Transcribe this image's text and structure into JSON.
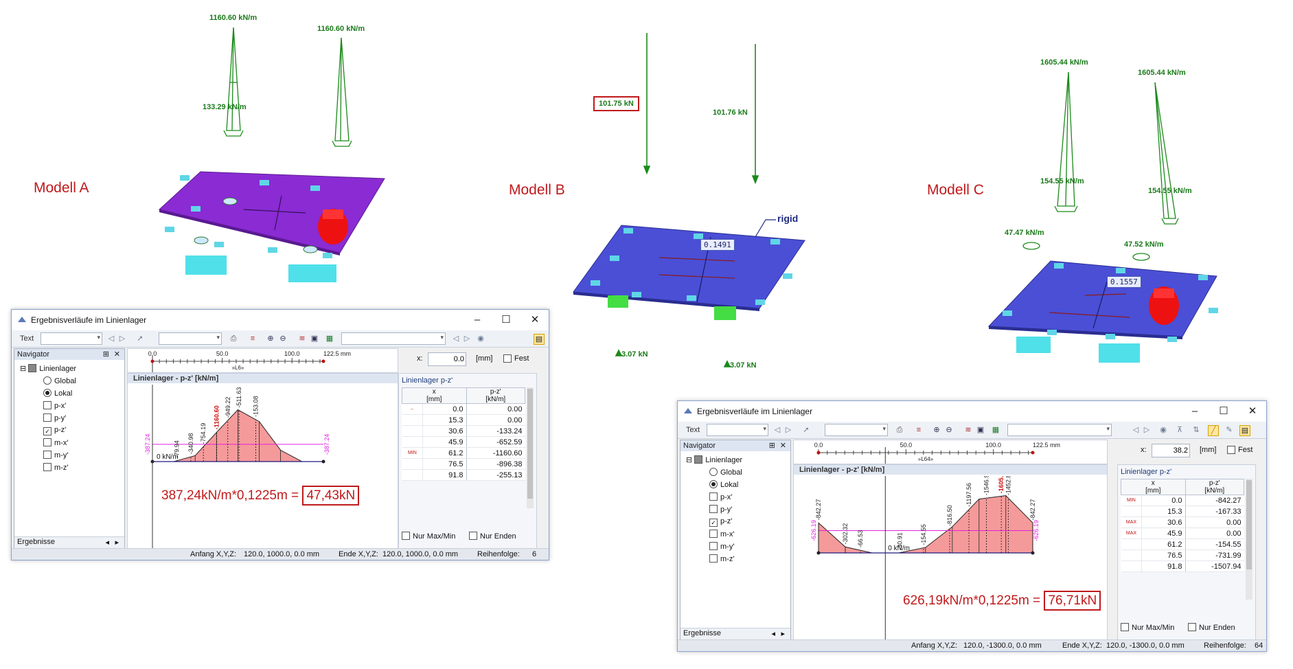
{
  "models": [
    {
      "label": "Modell A"
    },
    {
      "label": "Modell B"
    },
    {
      "label": "Modell C"
    }
  ],
  "model_a": {
    "load_left_top": "1160.60 kN/m",
    "load_right_top": "1160.60 kN/m",
    "load_mid": "133.29 kN/m"
  },
  "model_b": {
    "force_left": "101.75 kN",
    "force_right": "101.76 kN",
    "rigid_label": "rigid",
    "tag_value": "0.1491",
    "support_left": "3.07 kN",
    "support_right": "3.07 kN"
  },
  "model_c": {
    "load_left_top": "1605.44 kN/m",
    "load_right_top": "1605.44 kN/m",
    "load_left_mid": "154.55 kN/m",
    "load_right_mid": "154.55 kN/m",
    "load_left_low": "47.47 kN/m",
    "load_right_low": "47.52 kN/m",
    "tag_value": "0.1557"
  },
  "dialog_a": {
    "title": "Ergebnisverläufe im Linienlager",
    "toolbar_text_label": "Text",
    "navigator_label": "Navigator",
    "tree_root": "Linienlager",
    "tree_items": [
      "Global",
      "Lokal",
      "p-x'",
      "p-y'",
      "p-z'",
      "m-x'",
      "m-y'",
      "m-z'"
    ],
    "nav_footer": "Ergebnisse",
    "ruler_ticks": [
      "0.0",
      "50.0",
      "100.0",
      "122.5 mm"
    ],
    "ruler_member": "»L6»",
    "x_label": "x:",
    "x_value": "0.0",
    "x_unit": "[mm]",
    "fest_label": "Fest",
    "plot_title": "Linienlager - p-z' [kN/m]",
    "zero_label": "0 kN/m",
    "table_title": "Linienlager p-z'",
    "col_x": "x",
    "col_x_unit": "[mm]",
    "col_p": "p-z'",
    "col_p_unit": "[kN/m]",
    "rows": [
      {
        "mark": "←",
        "x": "0.0",
        "p": "0.00"
      },
      {
        "mark": "",
        "x": "15.3",
        "p": "0.00"
      },
      {
        "mark": "",
        "x": "30.6",
        "p": "-133.24"
      },
      {
        "mark": "",
        "x": "45.9",
        "p": "-652.59"
      },
      {
        "mark": "MIN",
        "x": "61.2",
        "p": "-1160.60"
      },
      {
        "mark": "",
        "x": "76.5",
        "p": "-896.38"
      },
      {
        "mark": "",
        "x": "91.8",
        "p": "-255.13"
      }
    ],
    "nur_maxmin": "Nur Max/Min",
    "nur_enden": "Nur Enden",
    "status_start_label": "Anfang X,Y,Z:",
    "status_start": "120.0, 1000.0, 0.0 mm",
    "status_end_label": "Ende X,Y,Z:",
    "status_end": "120.0, 1000.0, 0.0 mm",
    "status_order_label": "Reihenfolge:",
    "status_order": "6",
    "calc_text": "387,24kN/m*0,1225m = ",
    "calc_result": "47,43kN"
  },
  "dialog_c": {
    "title": "Ergebnisverläufe im Linienlager",
    "toolbar_text_label": "Text",
    "navigator_label": "Navigator",
    "tree_root": "Linienlager",
    "tree_items": [
      "Global",
      "Lokal",
      "p-x'",
      "p-y'",
      "p-z'",
      "m-x'",
      "m-y'",
      "m-z'"
    ],
    "nav_footer": "Ergebnisse",
    "ruler_ticks": [
      "0.0",
      "50.0",
      "100.0",
      "122.5 mm"
    ],
    "ruler_member": "»L64»",
    "x_label": "x:",
    "x_value": "38.2",
    "x_unit": "[mm]",
    "fest_label": "Fest",
    "plot_title": "Linienlager - p-z' [kN/m]",
    "zero_label": "0 kN/m",
    "table_title": "Linienlager p-z'",
    "col_x": "x",
    "col_x_unit": "[mm]",
    "col_p": "p-z'",
    "col_p_unit": "[kN/m]",
    "rows": [
      {
        "mark": "MIN",
        "x": "0.0",
        "p": "-842.27"
      },
      {
        "mark": "",
        "x": "15.3",
        "p": "-167.33"
      },
      {
        "mark": "MAX",
        "x": "30.6",
        "p": "0.00"
      },
      {
        "mark": "MAX",
        "x": "45.9",
        "p": "0.00"
      },
      {
        "mark": "",
        "x": "61.2",
        "p": "-154.55"
      },
      {
        "mark": "",
        "x": "76.5",
        "p": "-731.99"
      },
      {
        "mark": "",
        "x": "91.8",
        "p": "-1507.94"
      }
    ],
    "nur_maxmin": "Nur Max/Min",
    "nur_enden": "Nur Enden",
    "status_start_label": "Anfang X,Y,Z:",
    "status_start": "120.0, -1300.0, 0.0 mm",
    "status_end_label": "Ende X,Y,Z:",
    "status_end": "120.0, -1300.0, 0.0 mm",
    "status_order_label": "Reihenfolge:",
    "status_order": "64",
    "calc_text": "626,19kN/m*0,1225m = ",
    "calc_result": "76,71kN"
  },
  "chart_data": [
    {
      "type": "area",
      "title": "Linienlager - p-z' [kN/m]",
      "xlim": [
        0,
        122.5
      ],
      "reference_line": -387.24,
      "reference_labels": [
        "-387.24",
        "-387.24"
      ],
      "x": [
        0.0,
        15.3,
        30.6,
        45.9,
        61.2,
        76.5,
        91.8,
        107.1,
        122.5
      ],
      "values": [
        0,
        0,
        -133.24,
        -652.59,
        -1160.6,
        -896.38,
        -255.13,
        0,
        0
      ],
      "point_labels": [
        {
          "x": 17.5,
          "text": "-79.94"
        },
        {
          "x": 27.5,
          "text": "-340.98"
        },
        {
          "x": 36.5,
          "text": "-754.19"
        },
        {
          "x": 46.0,
          "text": "-1160.60",
          "highlight": true
        },
        {
          "x": 54.0,
          "text": "-949.22"
        },
        {
          "x": 62.0,
          "text": "-511.63"
        },
        {
          "x": 74.0,
          "text": "-153.08"
        }
      ]
    },
    {
      "type": "area",
      "title": "Linienlager - p-z' [kN/m]",
      "xlim": [
        0,
        122.5
      ],
      "reference_line": -626.19,
      "reference_labels": [
        "-626.19",
        "-626.19"
      ],
      "x": [
        0.0,
        15.3,
        30.6,
        45.9,
        61.2,
        76.5,
        91.8,
        107.1,
        122.5
      ],
      "values": [
        -842.27,
        -167.33,
        0,
        0,
        -154.55,
        -731.99,
        -1507.94,
        -1605.44,
        -842.27
      ],
      "point_labels": [
        {
          "x": 0.0,
          "text": "-842.27"
        },
        {
          "x": 15.3,
          "text": "-302.32"
        },
        {
          "x": 24.0,
          "text": "-66.53"
        },
        {
          "x": 46.5,
          "text": "-30.91"
        },
        {
          "x": 60.0,
          "text": "-154.55"
        },
        {
          "x": 75.0,
          "text": "-816.50"
        },
        {
          "x": 86.0,
          "text": "-1197.56"
        },
        {
          "x": 96.0,
          "text": "-1546.94"
        },
        {
          "x": 104.5,
          "text": "-1605.44",
          "highlight": true
        },
        {
          "x": 108.5,
          "text": "-1452.81"
        },
        {
          "x": 122.5,
          "text": "-842.27"
        }
      ]
    }
  ]
}
